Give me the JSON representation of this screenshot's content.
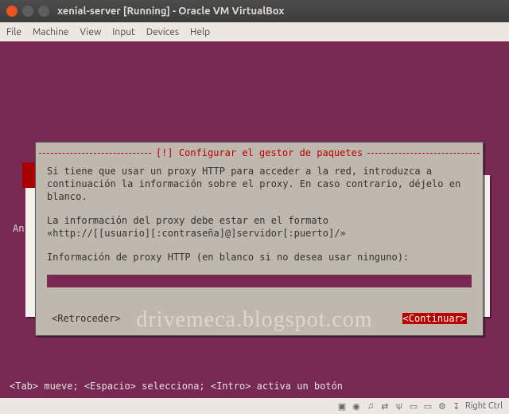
{
  "window": {
    "title": "xenial-server [Running] - Oracle VM VirtualBox"
  },
  "menu": {
    "items": [
      "File",
      "Machine",
      "View",
      "Input",
      "Devices",
      "Help"
    ]
  },
  "behind_text": "An",
  "dialog": {
    "title": "[!] Configurar el gestor de paquetes",
    "para1": "Si tiene que usar un proxy HTTP para acceder a la red, introduzca a continuación la información sobre el proxy. En caso contrario, déjelo en blanco.",
    "para2": "La información del proxy debe estar en el formato\n«http://[[usuario][:contraseña]@]servidor[:puerto]/»",
    "prompt": "Información de proxy HTTP (en blanco si no desea usar ninguno):",
    "back": "<Retroceder>",
    "continue": "<Continuar>"
  },
  "helpbar": "<Tab> mueve; <Espacio> selecciona; <Intro> activa un botón",
  "statusbar": {
    "hostkey": "Right Ctrl"
  },
  "watermark": "drivemeca.blogspot.com"
}
